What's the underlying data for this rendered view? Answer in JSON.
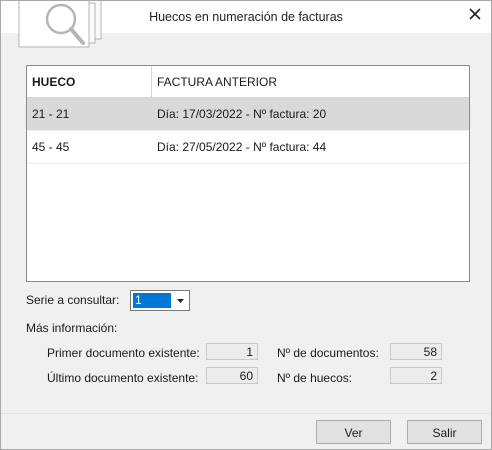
{
  "window": {
    "title": "Huecos en numeración de facturas"
  },
  "table": {
    "headers": [
      "HUECO",
      "FACTURA ANTERIOR"
    ],
    "rows": [
      {
        "hueco": "21 - 21",
        "factura": "Día: 17/03/2022 - Nº factura: 20"
      },
      {
        "hueco": "45 - 45",
        "factura": "Día: 27/05/2022 - Nº factura: 44"
      }
    ]
  },
  "serie": {
    "label": "Serie a consultar:",
    "value": "1"
  },
  "info": {
    "heading": "Más información:",
    "primer_label": "Primer documento existente:",
    "primer_value": "1",
    "ultimo_label": "Último documento existente:",
    "ultimo_value": "60",
    "num_docs_label": "Nº de documentos:",
    "num_docs_value": "58",
    "num_huecos_label": "Nº de huecos:",
    "num_huecos_value": "2"
  },
  "buttons": {
    "ver": "Ver",
    "salir": "Salir"
  },
  "colors": {
    "selection": "#0078d7",
    "selected_row": "#d9d9d9"
  },
  "icons": {
    "logo": "documents-magnifier-icon",
    "close": "close-icon",
    "dropdown": "chevron-down-icon"
  }
}
